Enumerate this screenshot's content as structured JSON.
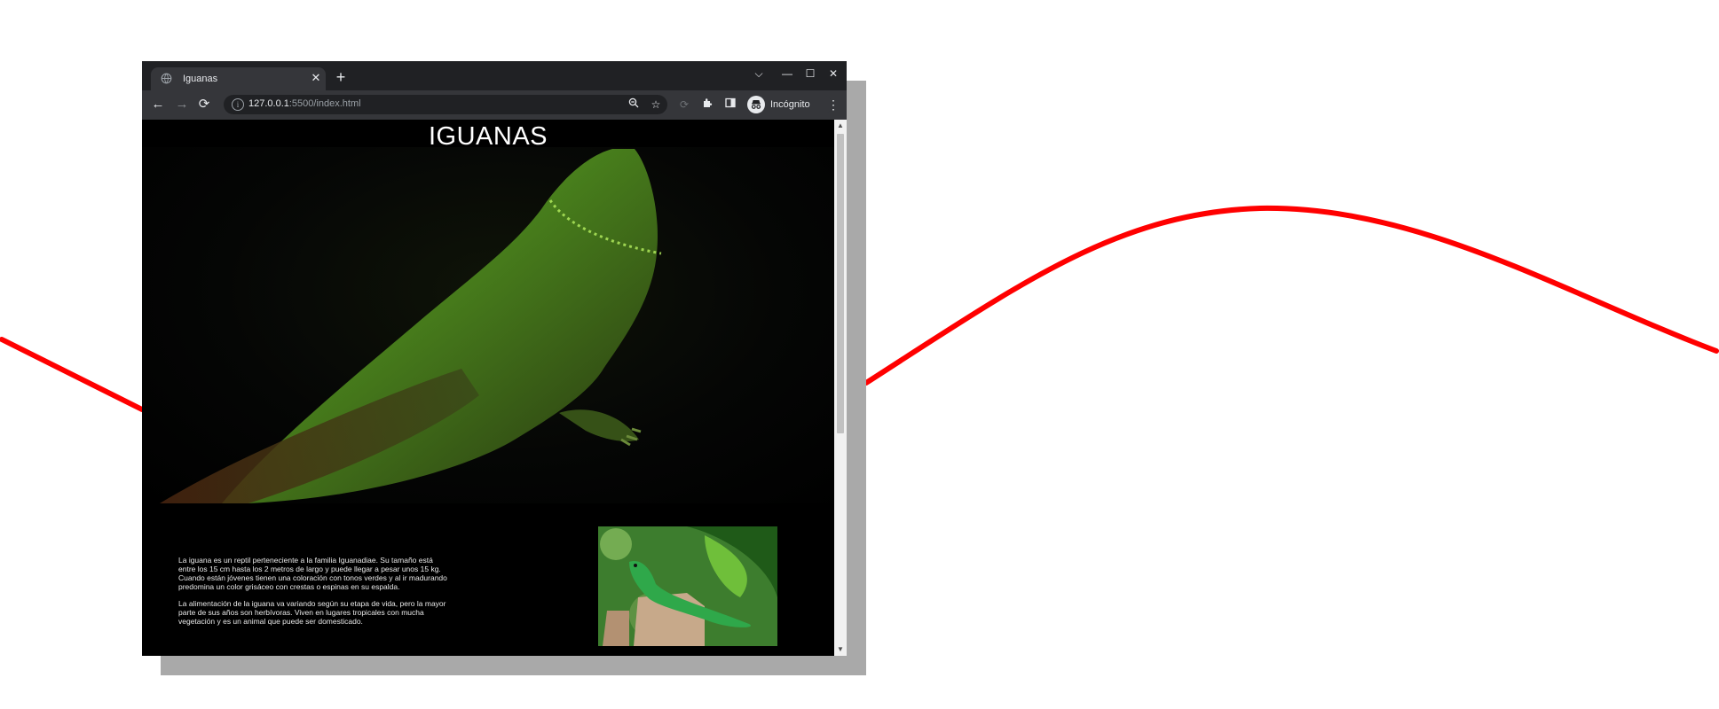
{
  "browser": {
    "tab_title": "Iguanas",
    "tab_close": "✕",
    "new_tab": "+",
    "window_controls": {
      "tab_search": "⌵",
      "minimize": "—",
      "maximize": "☐",
      "close": "✕"
    },
    "nav": {
      "back": "←",
      "forward": "→",
      "reload": "⟳"
    },
    "url_host": "127.0.0.1",
    "url_path": ":5500/index.html",
    "incognito_label": "Incógnito",
    "menu": "⋮",
    "icons": [
      "info-icon",
      "zoom-icon",
      "star-icon",
      "sync-icon",
      "extensions-icon",
      "side-panel-icon",
      "incognito-icon",
      "menu-icon"
    ]
  },
  "page": {
    "title": "IGUANAS",
    "paragraphs": [
      "La iguana es un reptil perteneciente a la familia Iguanadiae. Su tamaño está entre los 15 cm hasta los 2 metros de largo y puede llegar a pesar unos 15 kg. Cuando están jóvenes tienen una coloración con tonos verdes y al ir madurando predomina un color grisáceo con crestas o espinas en su espalda.",
      "La alimentación de la iguana va variando según su etapa de vida, pero la mayor parte de sus años son herbívoras. Viven en lugares tropicales con mucha vegetación y es un animal que puede ser domesticado."
    ]
  },
  "colors": {
    "accent_curve": "#ff0000",
    "tabbar": "#202124",
    "toolbar": "#35363a",
    "page_bg": "#000000"
  }
}
